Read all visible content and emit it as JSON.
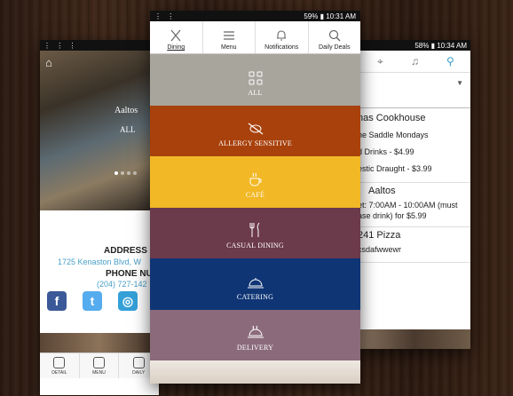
{
  "left_phone": {
    "status_bar": {
      "icons": "⋮ ⋮ ⋮"
    },
    "hero": {
      "title": "Aaltos",
      "subtitle": "ALL"
    },
    "address_title": "ADDRESS",
    "address_line": "1725 Kenaston Blvd, W",
    "phone_title": "PHONE NUMB",
    "phone_number": "(204) 727-142",
    "social": [
      {
        "name": "facebook",
        "glyph": "f",
        "color": "#3b5998"
      },
      {
        "name": "twitter",
        "glyph": "t",
        "color": "#55acee"
      },
      {
        "name": "tripadvisor",
        "glyph": "◎",
        "color": "#34a0d8"
      }
    ],
    "bottom_nav": [
      {
        "label": "DETAIL"
      },
      {
        "label": "MENU"
      },
      {
        "label": "DAILY"
      }
    ]
  },
  "center_phone": {
    "status_bar": {
      "left_icons": "⋮ ⋮",
      "right_text": "59% ▮ 10:31 AM"
    },
    "tabs": [
      {
        "label": "Dining",
        "icon": "fork-knife-icon",
        "active": true
      },
      {
        "label": "Menu",
        "icon": "hamburger-menu-icon",
        "active": false
      },
      {
        "label": "Notifications",
        "icon": "bell-icon",
        "active": false
      },
      {
        "label": "Daily Deals",
        "icon": "search-icon",
        "active": false
      }
    ],
    "categories": [
      {
        "label": "ALL",
        "color": "#a8a59d",
        "icon": "grid-icon"
      },
      {
        "label": "ALLERGY SENSITIVE",
        "color": "#a8410c",
        "icon": "no-peanut-icon"
      },
      {
        "label": "CAFÉ",
        "color": "#f2b825",
        "icon": "coffee-cup-icon"
      },
      {
        "label": "CASUAL DINING",
        "color": "#6b3a4b",
        "icon": "fork-knife-icon"
      },
      {
        "label": "CATERING",
        "color": "#0f3575",
        "icon": "cloche-icon"
      },
      {
        "label": "DELIVERY",
        "color": "#8b6b7b",
        "icon": "delivery-icon"
      }
    ]
  },
  "right_phone": {
    "status_bar": {
      "right_text": "58% ▮ 10:34 AM"
    },
    "rows": [
      {
        "lines": [
          "nas Cookhouse",
          "he Saddle Mondays",
          "d Drinks - $4.99",
          "estic Draught - $3.99"
        ]
      },
      {
        "lines": [
          "Aaltos",
          "et: 7:00AM - 10:00AM  (must",
          "ase drink) for $5.99"
        ]
      },
      {
        "lines": [
          "241 Pizza",
          "csdafwwewr"
        ]
      }
    ]
  }
}
